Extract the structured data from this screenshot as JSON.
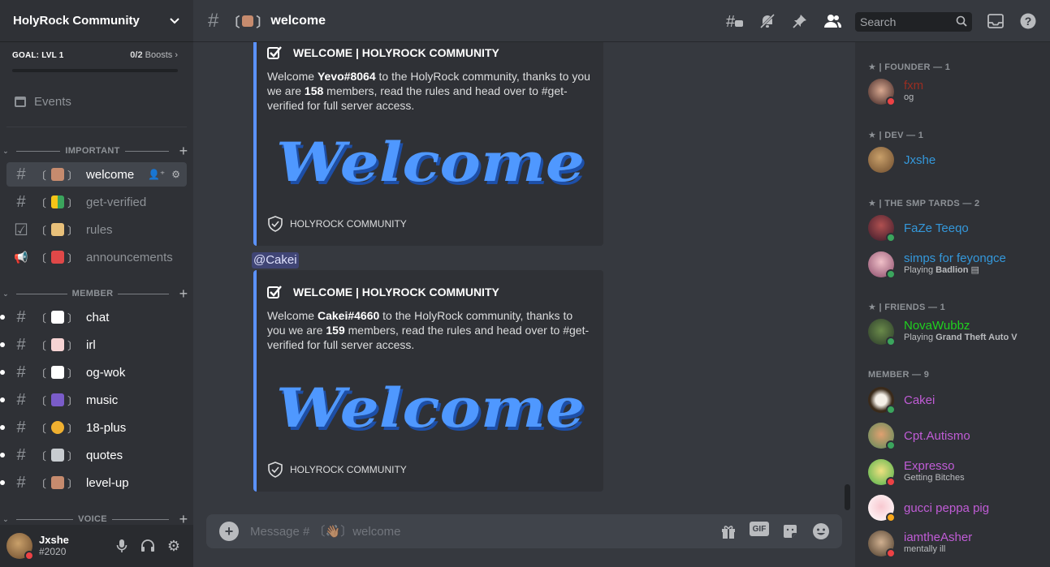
{
  "server": {
    "name": "HolyRock Community"
  },
  "goal": {
    "label": "GOAL: LVL 1",
    "count": "0/2",
    "boosts": "Boosts",
    "progress": 0
  },
  "events_label": "Events",
  "categories": {
    "important": "IMPORTANT",
    "member": "MEMBER",
    "voice": "VOICE"
  },
  "channels": {
    "welcome": "welcome",
    "get_verified": "get-verified",
    "rules": "rules",
    "announcements": "announcements",
    "chat": "chat",
    "irl": "irl",
    "og_wok": "og-wok",
    "music": "music",
    "eighteen_plus": "18-plus",
    "quotes": "quotes",
    "level_up": "level-up"
  },
  "user": {
    "name": "Jxshe",
    "tag": "#2020"
  },
  "header": {
    "title": "welcome",
    "search_placeholder": "Search"
  },
  "embeds": [
    {
      "title": "WELCOME | HOLYROCK COMMUNITY",
      "pre": "Welcome ",
      "user": "Yevo#8064",
      "mid": " to the HolyRock community, thanks to you we are ",
      "count": "158",
      "post": " members, read the rules and head over to #get-verified for full server access.",
      "image_text": "Welcome",
      "footer": "HOLYROCK COMMUNITY"
    },
    {
      "title": "WELCOME | HOLYROCK COMMUNITY",
      "pre": "Welcome ",
      "user": "Cakei#4660",
      "mid": " to the HolyRock community, thanks to you we are ",
      "count": "159",
      "post": " members, read the rules and head over to #get-verified for full server access.",
      "image_text": "Welcome",
      "footer": "HOLYROCK COMMUNITY"
    }
  ],
  "mention": "@Cakei",
  "composer": {
    "placeholder": "Message # 〔👋🏽〕welcome",
    "gif": "GIF"
  },
  "roles": {
    "founder": "★ | FOUNDER — 1",
    "dev": "★ | DEV — 1",
    "smp": "★ | THE SMP TARDS — 2",
    "friends": "★ | FRIENDS — 1",
    "member": "MEMBER — 9"
  },
  "members": [
    {
      "name": "fxm",
      "sub": "og",
      "color": "#992d22",
      "status": "dnd"
    },
    {
      "name": "Jxshe",
      "sub": "",
      "color": "#3498db",
      "status": "none"
    },
    {
      "name": "FaZe Teeqo",
      "sub": "",
      "color": "#3498db",
      "status": "online"
    },
    {
      "name": "simps for feyongce",
      "sub_pre": "Playing ",
      "sub_bold": "Badlion",
      "color": "#3498db",
      "status": "online"
    },
    {
      "name": "NovaWubbz",
      "sub_pre": "Playing ",
      "sub_bold": "Grand Theft Auto V",
      "color": "#1fd11f",
      "status": "online"
    },
    {
      "name": "Cakei",
      "sub": "",
      "color": "#c05cd6",
      "status": "online"
    },
    {
      "name": "Cpt.Autismo",
      "sub": "",
      "color": "#c05cd6",
      "status": "online"
    },
    {
      "name": "Expresso",
      "sub": "Getting Bitches",
      "color": "#c05cd6",
      "status": "dnd"
    },
    {
      "name": "gucci peppa pig",
      "sub": "",
      "color": "#c05cd6",
      "status": "idle"
    },
    {
      "name": "iamtheAsher",
      "sub": "mentally ill",
      "color": "#c05cd6",
      "status": "dnd"
    }
  ],
  "colors": {
    "accent": "#5865f2",
    "embed_border": "#5b92ff",
    "background": "#36393f",
    "sidebar": "#2f3136"
  }
}
